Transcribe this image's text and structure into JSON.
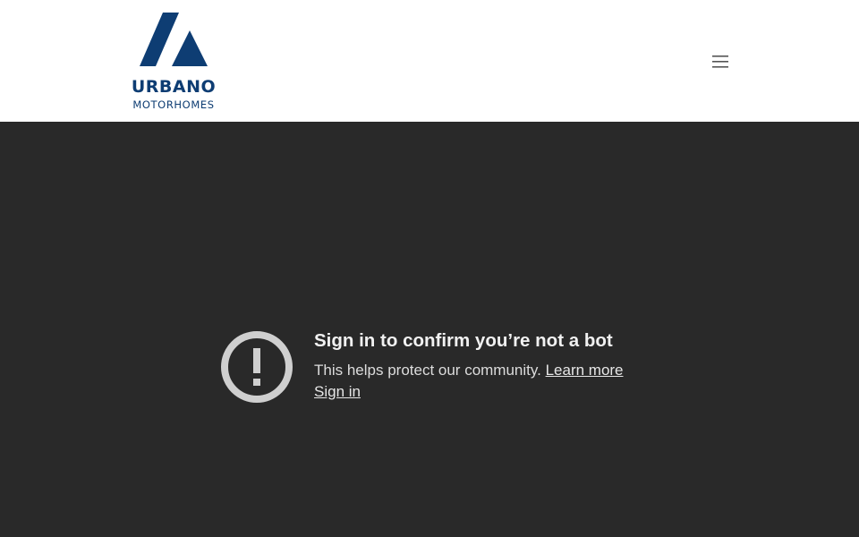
{
  "header": {
    "logo": {
      "name": "URBANO",
      "subtitle": "MOTORHOMES",
      "brand_color": "#0e3d73"
    },
    "menu_icon": "hamburger-menu-icon"
  },
  "player": {
    "background_color": "#292929",
    "icon": "alert-circle-icon",
    "title": "Sign in to confirm you’re not a bot",
    "body_text": "This helps protect our community.",
    "learn_more_label": "Learn more",
    "sign_in_label": "Sign in"
  }
}
